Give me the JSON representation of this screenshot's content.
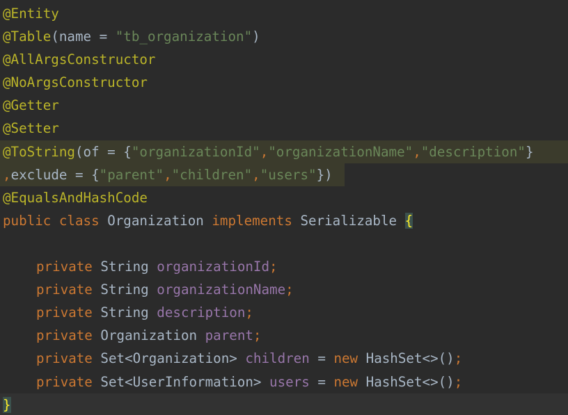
{
  "code": {
    "lines": [
      {
        "segments": [
          {
            "t": "@Entity",
            "c": "ann"
          }
        ]
      },
      {
        "segments": [
          {
            "t": "@Table",
            "c": "ann"
          },
          {
            "t": "(name = ",
            "c": "pl"
          },
          {
            "t": "\"tb_organization\"",
            "c": "str"
          },
          {
            "t": ")",
            "c": "pl"
          }
        ]
      },
      {
        "segments": [
          {
            "t": "@AllArgsConstructor",
            "c": "ann"
          }
        ]
      },
      {
        "segments": [
          {
            "t": "@NoArgsConstructor",
            "c": "ann"
          }
        ]
      },
      {
        "segments": [
          {
            "t": "@Getter",
            "c": "ann"
          }
        ]
      },
      {
        "segments": [
          {
            "t": "@Setter",
            "c": "ann"
          }
        ]
      },
      {
        "segments": [
          {
            "t": "@ToString",
            "c": "ann"
          },
          {
            "t": "(of = {",
            "c": "pl"
          },
          {
            "t": "\"organizationId\"",
            "c": "str"
          },
          {
            "t": ",",
            "c": "kw"
          },
          {
            "t": "\"organizationName\"",
            "c": "str"
          },
          {
            "t": ",",
            "c": "kw"
          },
          {
            "t": "\"description\"",
            "c": "str"
          },
          {
            "t": "}",
            "c": "pl"
          }
        ]
      },
      {
        "segments": [
          {
            "t": ",",
            "c": "kw"
          },
          {
            "t": "exclude = {",
            "c": "pl"
          },
          {
            "t": "\"parent\"",
            "c": "str"
          },
          {
            "t": ",",
            "c": "kw"
          },
          {
            "t": "\"children\"",
            "c": "str"
          },
          {
            "t": ",",
            "c": "kw"
          },
          {
            "t": "\"users\"",
            "c": "str"
          },
          {
            "t": "})",
            "c": "pl"
          }
        ]
      },
      {
        "segments": [
          {
            "t": "@EqualsAndHashCode",
            "c": "ann"
          }
        ]
      },
      {
        "segments": [
          {
            "t": "public class ",
            "c": "kw"
          },
          {
            "t": "Organization ",
            "c": "pl"
          },
          {
            "t": "implements ",
            "c": "kw"
          },
          {
            "t": "Serializable ",
            "c": "pl"
          },
          {
            "t": "{",
            "c": "brace-hl"
          }
        ]
      },
      {
        "segments": []
      },
      {
        "segments": [
          {
            "t": "private ",
            "c": "kw"
          },
          {
            "t": "String ",
            "c": "pl"
          },
          {
            "t": "organizationId",
            "c": "fld"
          },
          {
            "t": ";",
            "c": "kw"
          }
        ]
      },
      {
        "segments": [
          {
            "t": "private ",
            "c": "kw"
          },
          {
            "t": "String ",
            "c": "pl"
          },
          {
            "t": "organizationName",
            "c": "fld"
          },
          {
            "t": ";",
            "c": "kw"
          }
        ]
      },
      {
        "segments": [
          {
            "t": "private ",
            "c": "kw"
          },
          {
            "t": "String ",
            "c": "pl"
          },
          {
            "t": "description",
            "c": "fld"
          },
          {
            "t": ";",
            "c": "kw"
          }
        ]
      },
      {
        "segments": [
          {
            "t": "private ",
            "c": "kw"
          },
          {
            "t": "Organization ",
            "c": "pl"
          },
          {
            "t": "parent",
            "c": "fld"
          },
          {
            "t": ";",
            "c": "kw"
          }
        ]
      },
      {
        "segments": [
          {
            "t": "private ",
            "c": "kw"
          },
          {
            "t": "Set<Organization> ",
            "c": "pl"
          },
          {
            "t": "children ",
            "c": "fld"
          },
          {
            "t": "= ",
            "c": "pl"
          },
          {
            "t": "new ",
            "c": "kw"
          },
          {
            "t": "HashSet<>()",
            "c": "pl"
          },
          {
            "t": ";",
            "c": "kw"
          }
        ]
      },
      {
        "segments": [
          {
            "t": "private ",
            "c": "kw"
          },
          {
            "t": "Set<UserInformation> ",
            "c": "pl"
          },
          {
            "t": "users ",
            "c": "fld"
          },
          {
            "t": "= ",
            "c": "pl"
          },
          {
            "t": "new ",
            "c": "kw"
          },
          {
            "t": "HashSet<>()",
            "c": "pl"
          },
          {
            "t": ";",
            "c": "kw"
          }
        ]
      },
      {
        "segments": [
          {
            "t": "}",
            "c": "brace-hl"
          }
        ]
      }
    ]
  },
  "colors": {
    "background": "#2b2b2b",
    "annotation": "#bbb529",
    "keyword": "#cc7832",
    "string": "#6a8759",
    "field": "#9876aa",
    "plain": "#a9b7c6",
    "selection": "#3b3b2c",
    "current_line": "#323232",
    "brace_match_bg": "#3b514d",
    "brace_match_fg": "#ffef28"
  }
}
